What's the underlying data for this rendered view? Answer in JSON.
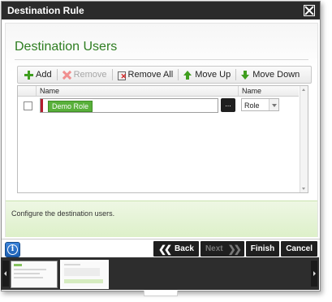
{
  "window": {
    "title": "Destination Rule"
  },
  "page": {
    "section_title": "Destination Users"
  },
  "toolbar": {
    "add": "Add",
    "remove": "Remove",
    "remove_all": "Remove All",
    "move_up": "Move Up",
    "move_down": "Move Down"
  },
  "grid": {
    "columns": [
      "Name",
      "Name"
    ],
    "rows": [
      {
        "role_tag": "Demo Role",
        "lookup_label": "...",
        "type_value": "Role"
      }
    ]
  },
  "info": {
    "text": "Configure the destination users."
  },
  "footer": {
    "back": "Back",
    "next": "Next",
    "finish": "Finish",
    "cancel": "Cancel"
  },
  "colors": {
    "title_bar": "#2b2b2b",
    "section_title": "#2e7d20",
    "role_tag": "#59b03b",
    "required_marker": "#b31d2e",
    "info_bar": "#ddf0c9",
    "nav_button": "#1f1f1f"
  },
  "icons": {
    "close": "close-icon",
    "add": "plus-icon",
    "remove": "x-icon",
    "remove_all": "trash-icon",
    "move_up": "arrow-up-icon",
    "move_down": "arrow-down-icon",
    "info": "info-icon",
    "back": "chevron-double-left-icon",
    "next": "chevron-double-right-icon"
  }
}
